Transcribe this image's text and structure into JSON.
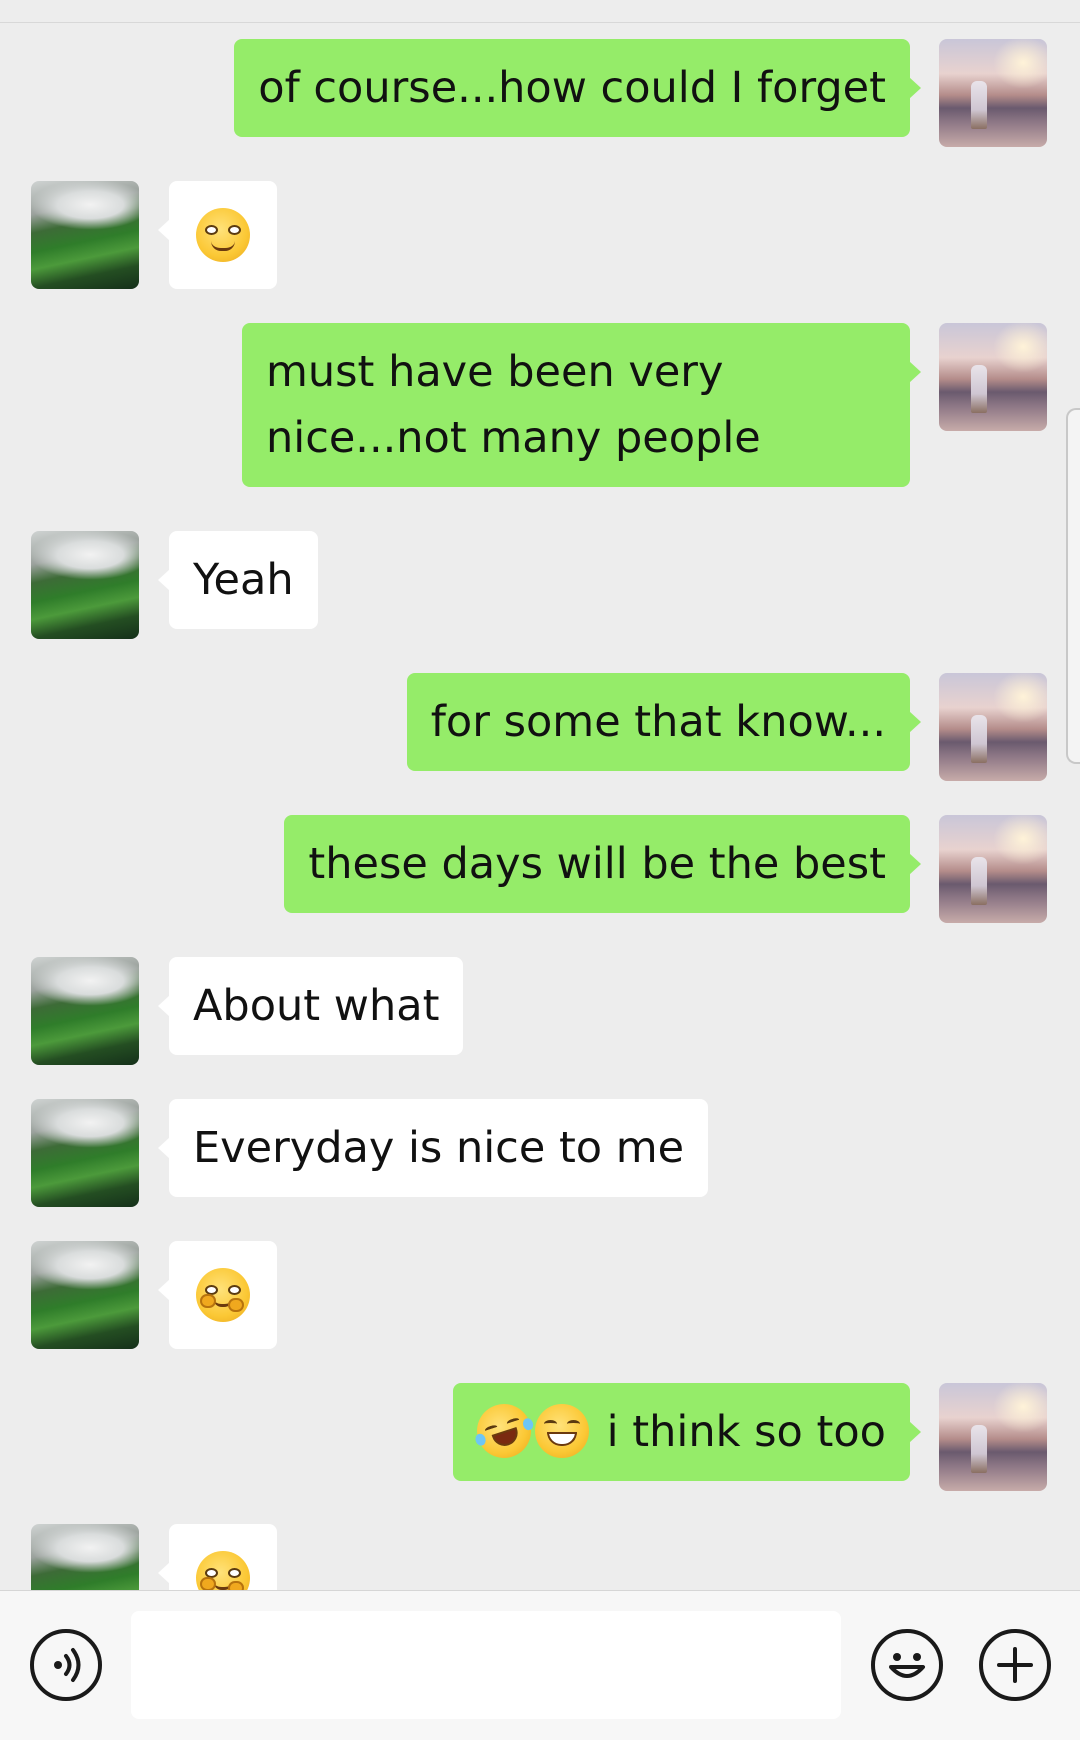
{
  "chat": {
    "messages": [
      {
        "side": "outgoing",
        "text": "of course...how could I forget"
      },
      {
        "side": "incoming",
        "emoji": "smirk-face-icon"
      },
      {
        "side": "outgoing",
        "text": "must have been very nice...not many people"
      },
      {
        "side": "incoming",
        "text": "Yeah"
      },
      {
        "side": "outgoing",
        "text": "for some that know..."
      },
      {
        "side": "outgoing",
        "text": "these days will be the best"
      },
      {
        "side": "incoming",
        "text": "About what"
      },
      {
        "side": "incoming",
        "text": "Everyday is nice to me"
      },
      {
        "side": "incoming",
        "emoji": "hugging-face-icon"
      },
      {
        "side": "outgoing",
        "emojis": [
          "rolling-laughing-face-icon",
          "grinning-face-icon"
        ],
        "text": "i think so too"
      },
      {
        "side": "incoming",
        "emoji": "hugging-face-icon"
      }
    ]
  },
  "input_bar": {
    "voice_icon": "voice-input-icon",
    "text_value": "",
    "emoji_icon": "smiley-face-icon",
    "plus_icon": "plus-icon"
  },
  "colors": {
    "background": "#ededed",
    "outgoing_bubble": "#95ec69",
    "incoming_bubble": "#ffffff"
  }
}
